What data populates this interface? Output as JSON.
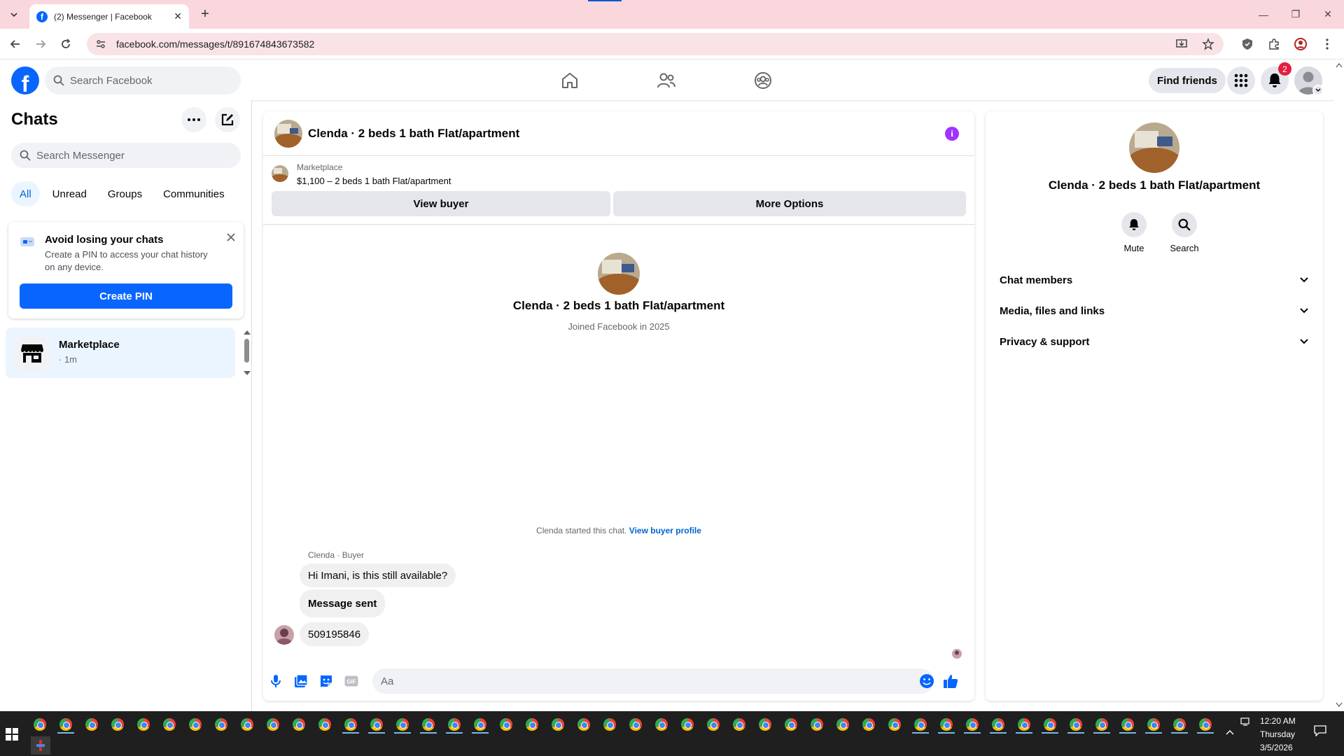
{
  "browser": {
    "tab_title": "(2) Messenger | Facebook",
    "url": "facebook.com/messages/t/891674843673582"
  },
  "fb_header": {
    "search_placeholder": "Search Facebook",
    "find_friends_label": "Find friends",
    "notification_count": "2"
  },
  "sidebar": {
    "title": "Chats",
    "search_placeholder": "Search Messenger",
    "filters": [
      "All",
      "Unread",
      "Groups",
      "Communities"
    ],
    "active_filter": "All",
    "pin_card": {
      "title": "Avoid losing your chats",
      "body": "Create a PIN to access your chat history on any device.",
      "button": "Create PIN"
    },
    "conversations": [
      {
        "name": "Marketplace",
        "time": "· 1m"
      }
    ]
  },
  "conversation": {
    "title": "Clenda · 2 beds 1 bath Flat/apartment",
    "marketplace_label": "Marketplace",
    "listing": "$1,100 – 2 beds 1 bath Flat/apartment",
    "view_buyer_label": "View buyer",
    "more_options_label": "More Options",
    "intro_name": "Clenda · 2 beds 1 bath Flat/apartment",
    "intro_sub": "Joined Facebook in 2025",
    "started_text": "Clenda started this chat.",
    "started_link": "View buyer profile",
    "sender_label": "Clenda · Buyer",
    "messages": [
      {
        "text": "Hi Imani, is this still available?"
      },
      {
        "text": "Message sent"
      },
      {
        "text": "509195846"
      }
    ],
    "composer_placeholder": "Aa"
  },
  "details": {
    "name": "Clenda · 2 beds 1 bath Flat/apartment",
    "actions": [
      "Mute",
      "Search"
    ],
    "sections": [
      "Chat members",
      "Media, files and links",
      "Privacy & support"
    ]
  },
  "taskbar": {
    "time": "12:20 AM",
    "day": "Thursday",
    "date": "3/5/2026"
  },
  "colors": {
    "fb_blue": "#0866ff",
    "tab_strip": "#f9d7dc",
    "badge_red": "#e41e3f",
    "info_purple": "#a033ff",
    "selected_bg": "#ebf5ff"
  }
}
